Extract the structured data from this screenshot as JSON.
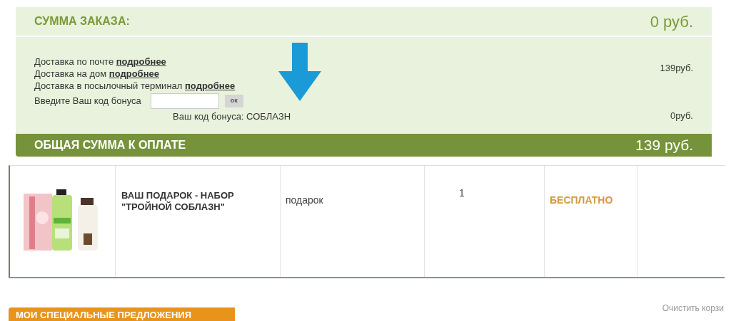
{
  "summary": {
    "title": "СУММА ЗАКАЗА:",
    "amount": "0 руб.",
    "delivery": [
      {
        "text": "Доставка по почте",
        "link": "подробнее"
      },
      {
        "text": "Доставка на дом",
        "link": "подробнее"
      },
      {
        "text": "Доставка в посылочный терминал",
        "link": "подробнее"
      }
    ],
    "delivery_price": "139руб.",
    "bonus": {
      "label": "Введите Ваш код бонуса",
      "button": "ок",
      "status": "Ваш код бонуса: СОБЛАЗН",
      "price": "0руб."
    },
    "total_label": "ОБЩАЯ СУММА К ОПЛАТЕ",
    "total": "139 руб."
  },
  "table": {
    "rows": [
      {
        "name": "ВАШ ПОДАРОК - НАБОР \"ТРОЙНОЙ СОБЛАЗН\"",
        "type": "подарок",
        "quantity": "1",
        "price": "БЕСПЛАТНО"
      }
    ]
  },
  "clear_cart": "Очистить корзи",
  "offers_tab": "МОИ СПЕЦИАЛЬНЫЕ ПРЕДЛОЖЕНИЯ"
}
